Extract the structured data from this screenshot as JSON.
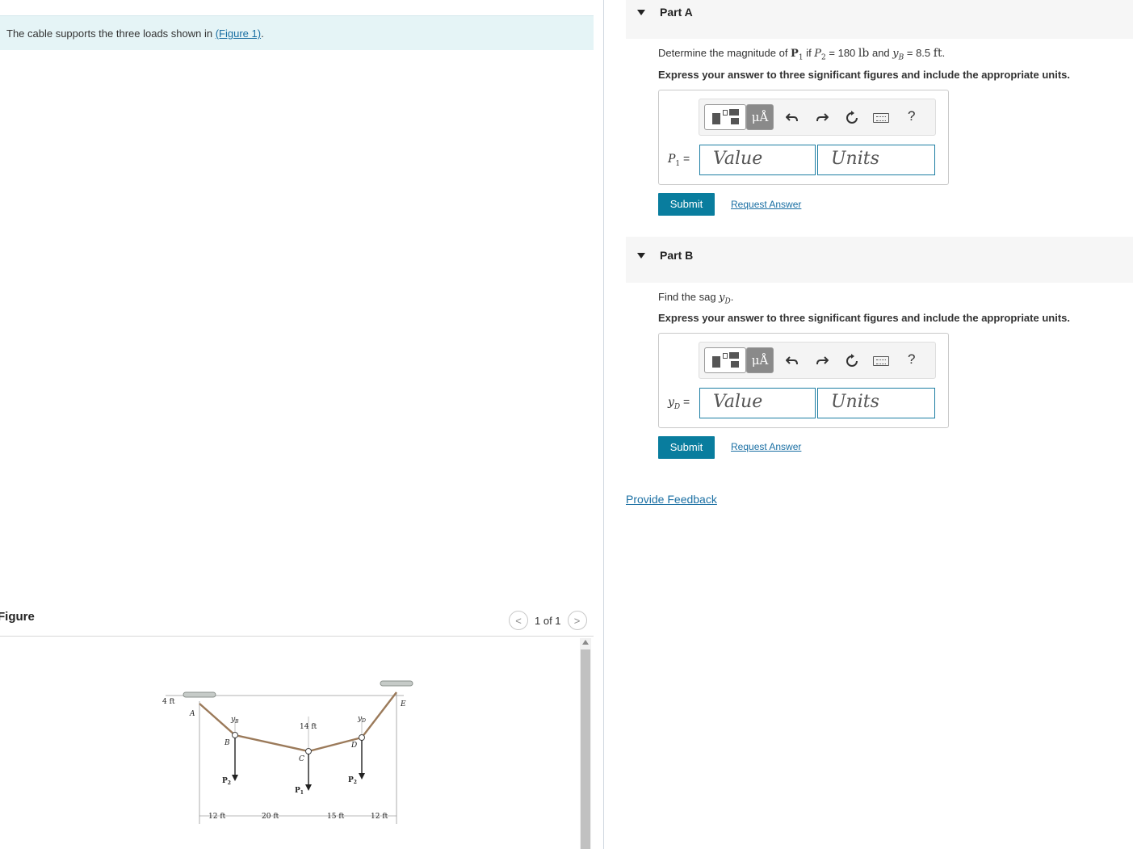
{
  "problem": {
    "text": "The cable supports the three loads shown in ",
    "link": "(Figure 1)",
    "end": "."
  },
  "figure": {
    "title": "Figure",
    "pager": {
      "prev": "<",
      "count": "1 of 1",
      "next": ">"
    },
    "labels": {
      "dim_4ft": "4 ft",
      "A": "A",
      "B": "B",
      "C": "C",
      "D": "D",
      "E": "E",
      "yB": "y",
      "yB_sub": "B",
      "yD": "y",
      "yD_sub": "D",
      "dim_14ft": "14 ft",
      "P1": "P",
      "P1_sub": "1",
      "P2_left": "P",
      "P2_left_sub": "2",
      "P2_right": "P",
      "P2_right_sub": "2",
      "dim_12ft_left": "12 ft",
      "dim_20ft": "20 ft",
      "dim_15ft": "15 ft",
      "dim_12ft_right": "12 ft"
    }
  },
  "partA": {
    "label": "Part A",
    "q_prefix": "Determine the magnitude of ",
    "q_P1": "P",
    "q_P1_sub": "1",
    "q_mid": " if ",
    "q_P2": "P",
    "q_P2_sub": "2",
    "q_eq1": " = 180 ",
    "q_unit1": "lb",
    "q_and": " and ",
    "q_yB": "y",
    "q_yB_sub": "B",
    "q_eq2": " = 8.5 ",
    "q_unit2": "ft",
    "q_end": ".",
    "instruction": "Express your answer to three significant figures and include the appropriate units.",
    "var": "P",
    "var_sub": "1",
    "var_eq": " =",
    "value_placeholder": "Value",
    "units_placeholder": "Units",
    "submit": "Submit",
    "request": "Request Answer"
  },
  "partB": {
    "label": "Part B",
    "q_prefix": "Find the sag ",
    "q_y": "y",
    "q_y_sub": "D",
    "q_end": ".",
    "instruction": "Express your answer to three significant figures and include the appropriate units.",
    "var": "y",
    "var_sub": "D",
    "var_eq": " =",
    "value_placeholder": "Value",
    "units_placeholder": "Units",
    "submit": "Submit",
    "request": "Request Answer"
  },
  "toolbar": {
    "mu": "μÅ",
    "help": "?"
  },
  "feedback": "Provide Feedback"
}
